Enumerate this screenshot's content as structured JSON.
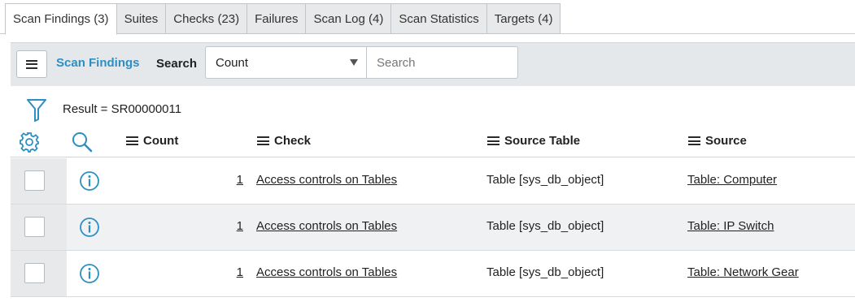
{
  "tabs": [
    {
      "label": "Scan Findings (3)",
      "active": true
    },
    {
      "label": "Suites"
    },
    {
      "label": "Checks (23)"
    },
    {
      "label": "Failures"
    },
    {
      "label": "Scan Log (4)"
    },
    {
      "label": "Scan Statistics"
    },
    {
      "label": "Targets (4)"
    }
  ],
  "toolbar": {
    "list_title": "Scan Findings",
    "search_label": "Search",
    "search_field_selected": "Count",
    "search_placeholder": "Search",
    "search_value": ""
  },
  "filter": {
    "text": "Result = SR00000011"
  },
  "columns": {
    "count": "Count",
    "check": "Check",
    "source_table": "Source Table",
    "source": "Source"
  },
  "rows": [
    {
      "count": "1",
      "check": "Access controls on Tables",
      "source_table": "Table [sys_db_object]",
      "source": "Table: Computer"
    },
    {
      "count": "1",
      "check": "Access controls on Tables",
      "source_table": "Table [sys_db_object]",
      "source": "Table: IP Switch"
    },
    {
      "count": "1",
      "check": "Access controls on Tables",
      "source_table": "Table [sys_db_object]",
      "source": "Table: Network Gear"
    }
  ],
  "icons": {
    "menu": "hamburger-menu-icon",
    "filter": "filter-funnel-icon",
    "settings": "gear-icon",
    "search": "magnifier-icon",
    "info": "info-circle-icon",
    "column_menu": "column-menu-icon"
  },
  "colors": {
    "accent": "#2b8fc4",
    "toolbar_bg": "#e5e8eb",
    "tab_bg": "#e7e9eb"
  }
}
